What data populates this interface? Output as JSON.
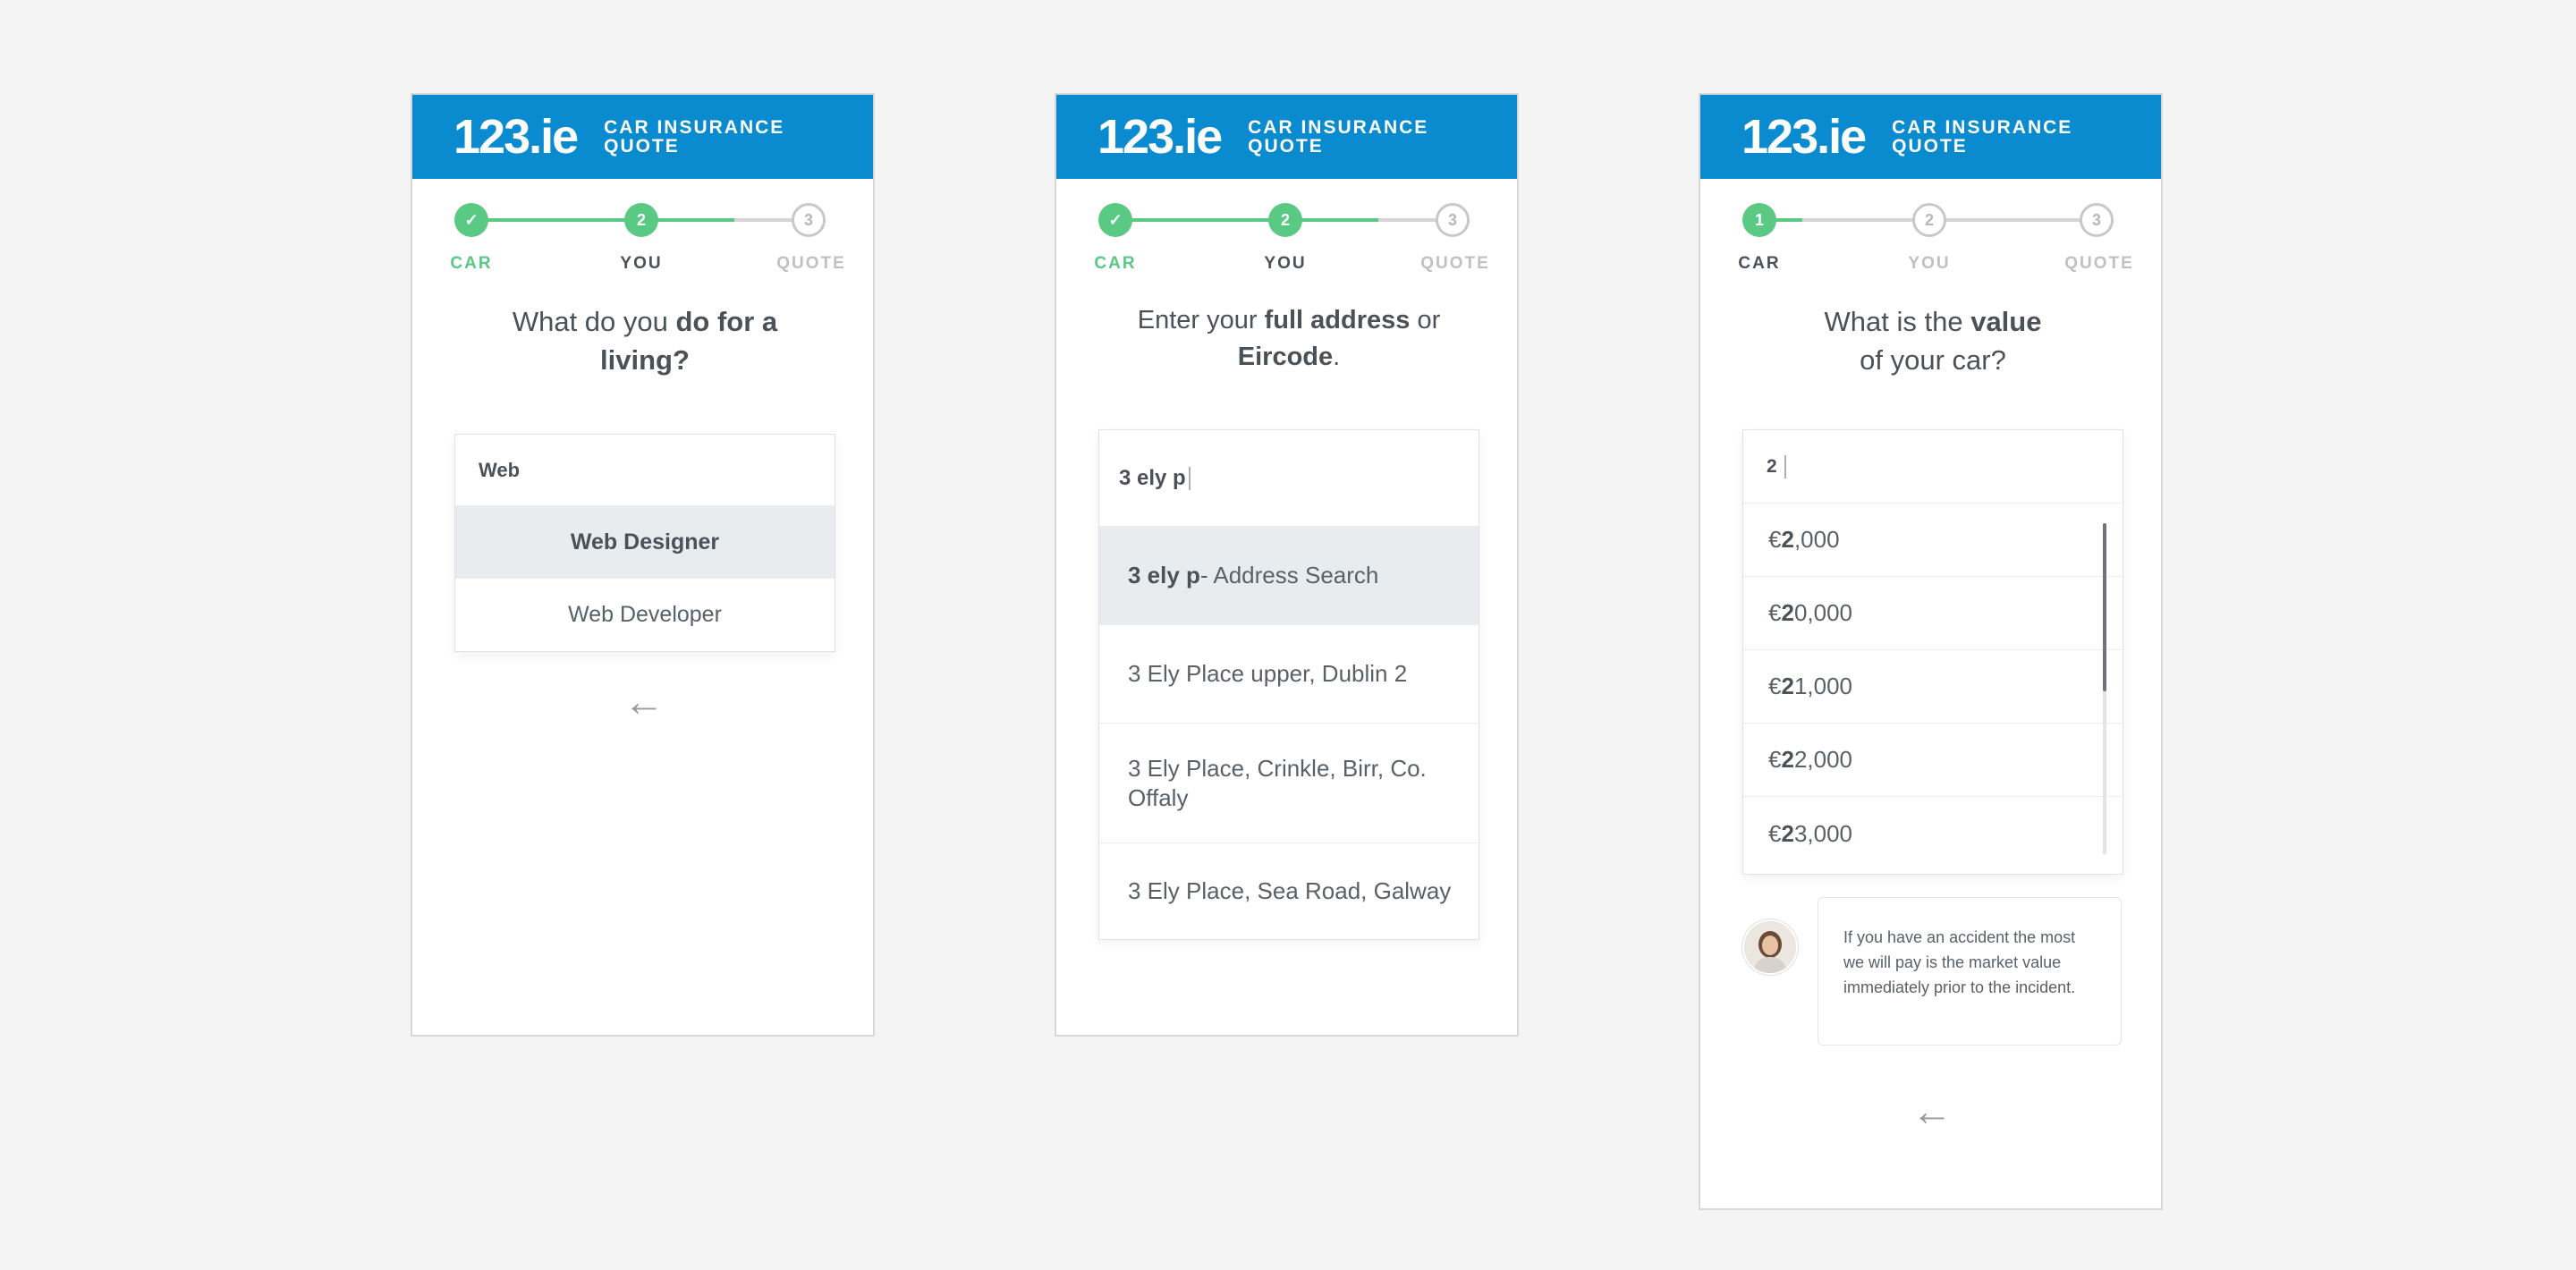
{
  "brand": {
    "logo": "123.ie",
    "title": "CAR INSURANCE QUOTE",
    "color": "#0a8bd0",
    "accent": "#59c983"
  },
  "screens": [
    {
      "steps": [
        {
          "num": "✓",
          "label": "CAR",
          "state": "done"
        },
        {
          "num": "2",
          "label": "YOU",
          "state": "current"
        },
        {
          "num": "3",
          "label": "QUOTE",
          "state": "todo"
        }
      ],
      "question": {
        "pre": "What do you ",
        "bold": "do for a living?",
        "post": ""
      },
      "input_value": "Web",
      "options": [
        "Web Designer",
        "Web Developer"
      ],
      "back_icon": "arrow-left-icon"
    },
    {
      "steps": [
        {
          "num": "✓",
          "label": "CAR",
          "state": "done"
        },
        {
          "num": "2",
          "label": "YOU",
          "state": "current"
        },
        {
          "num": "3",
          "label": "QUOTE",
          "state": "todo"
        }
      ],
      "question": {
        "pre": "Enter your ",
        "bold": "full address",
        "mid": " or ",
        "bold2": "Eircode",
        "post": "."
      },
      "input_value": "3 ely p",
      "options": [
        {
          "bold": "3 ely p",
          "rest": " - Address Search"
        },
        {
          "text": "3 Ely Place upper, Dublin 2"
        },
        {
          "text": "3 Ely Place, Crinkle, Birr, Co. Offaly"
        },
        {
          "text": "3 Ely Place, Sea Road, Galway"
        }
      ]
    },
    {
      "steps": [
        {
          "num": "1",
          "label": "CAR",
          "state": "current"
        },
        {
          "num": "2",
          "label": "YOU",
          "state": "todo"
        },
        {
          "num": "3",
          "label": "QUOTE",
          "state": "todo"
        }
      ],
      "question": {
        "pre": "What is the ",
        "bold": "value",
        "post": "of your car?"
      },
      "input_value": "2",
      "options": [
        {
          "cur": "€",
          "bold": "2",
          "rest": ",000"
        },
        {
          "cur": "€",
          "bold": "2",
          "rest": "0,000"
        },
        {
          "cur": "€",
          "bold": "2",
          "rest": "1,000"
        },
        {
          "cur": "€",
          "bold": "2",
          "rest": "2,000"
        },
        {
          "cur": "€",
          "bold": "2",
          "rest": "3,000"
        }
      ],
      "tip": "If you have an accident the most we will pay is the market value immediately prior to the incident.",
      "back_icon": "arrow-left-icon"
    }
  ]
}
